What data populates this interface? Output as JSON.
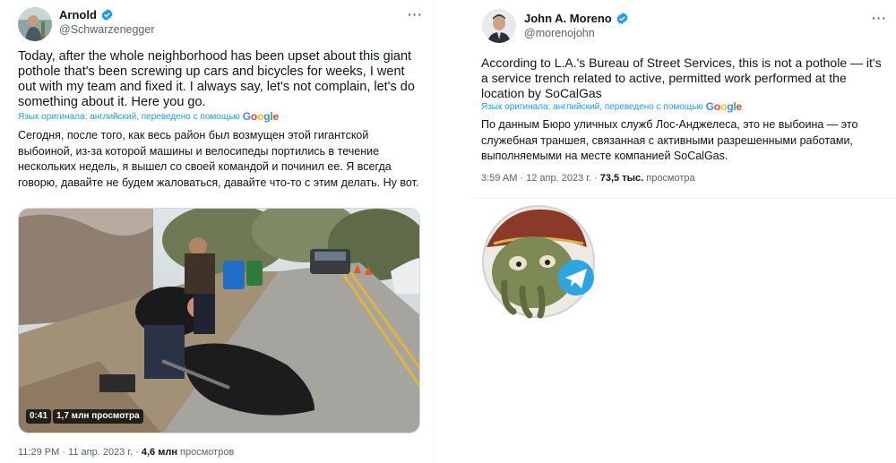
{
  "left_tweet": {
    "author": {
      "name": "Arnold",
      "handle": "@Schwarzenegger",
      "avatar_icon": "person-photo-avatar"
    },
    "more_label": "···",
    "text_en": "Today, after the whole neighborhood has been upset about this giant pothole that's been screwing up cars and bicycles for weeks, I went out with my team and fixed it. I always say, let's not complain, let's do something about it. Here you go.",
    "translated_label": "Язык оригинала: английский, переведено с помощью",
    "google_logo": "Google",
    "text_ru": "Сегодня, после того, как весь район был возмущен этой гигантской выбоиной, из-за которой машины и велосипеды портились в течение нескольких недель, я вышел со своей командой и починил ее. Я всегда говорю, давайте не будем жаловаться, давайте что-то с этим делать. Ну вот.",
    "video": {
      "duration": "0:41",
      "views": "1,7 млн просмотра"
    },
    "meta": {
      "time": "11:29 PM · 11 апр. 2023 г. · ",
      "views_count": "4,6 млн",
      "views_label": " просмотров"
    }
  },
  "right_tweet": {
    "author": {
      "name": "John A. Moreno",
      "handle": "@morenojohn",
      "avatar_icon": "person-photo-avatar"
    },
    "more_label": "···",
    "text_en": "According to L.A.'s Bureau of Street Services, this is not a pothole — it's a service trench related to active, permitted work performed at the location by SoCalGas",
    "translated_label": "Язык оригинала: английский, переведено с помощью",
    "google_logo": "Google",
    "text_ru": "По данным Бюро уличных служб Лос-Анджелеса, это не выбоина — это служебная траншея, связанная с активными разрешенными работами, выполняемыми на месте компанией SoCalGas.",
    "meta": {
      "time": "3:59 AM · 12 апр. 2023 г. · ",
      "views_count": "73,5 тыс.",
      "views_label": " просмотра"
    }
  },
  "sticker_icon": "pirate-octopus-telegram-sticker",
  "colors": {
    "verified": "#1d9bf0",
    "link": "#1d9bf0",
    "secondary": "#536471"
  }
}
